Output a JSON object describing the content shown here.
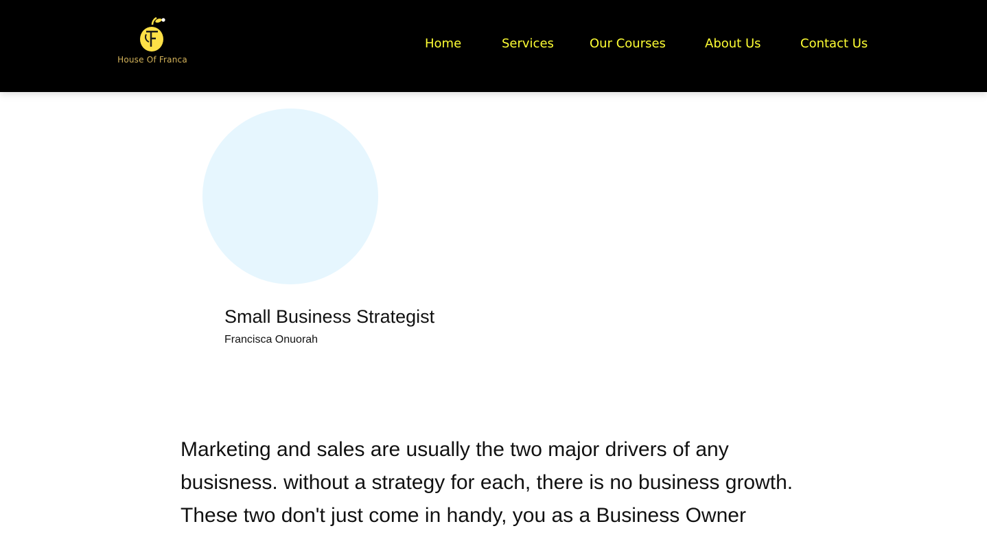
{
  "header": {
    "logo_text": "House Of Franca",
    "logo_letter": "F",
    "nav": [
      {
        "label": "Home"
      },
      {
        "label": "Services"
      },
      {
        "label": "Our Courses"
      },
      {
        "label": "About Us"
      },
      {
        "label": "Contact Us"
      }
    ]
  },
  "profile": {
    "role": "Small Business Strategist",
    "name": "Francisca Onuorah",
    "avatar_color": "#e6f6fe"
  },
  "intro_text": "Marketing and sales are usually the two major drivers of any busisness. without a strategy for each, there is no business growth. These two don't just come in handy, you as a Business Owner",
  "colors": {
    "header_bg": "#000000",
    "nav_text": "#ffff33",
    "logo_yellow": "#fde047",
    "logo_gold": "#d4b35a"
  }
}
